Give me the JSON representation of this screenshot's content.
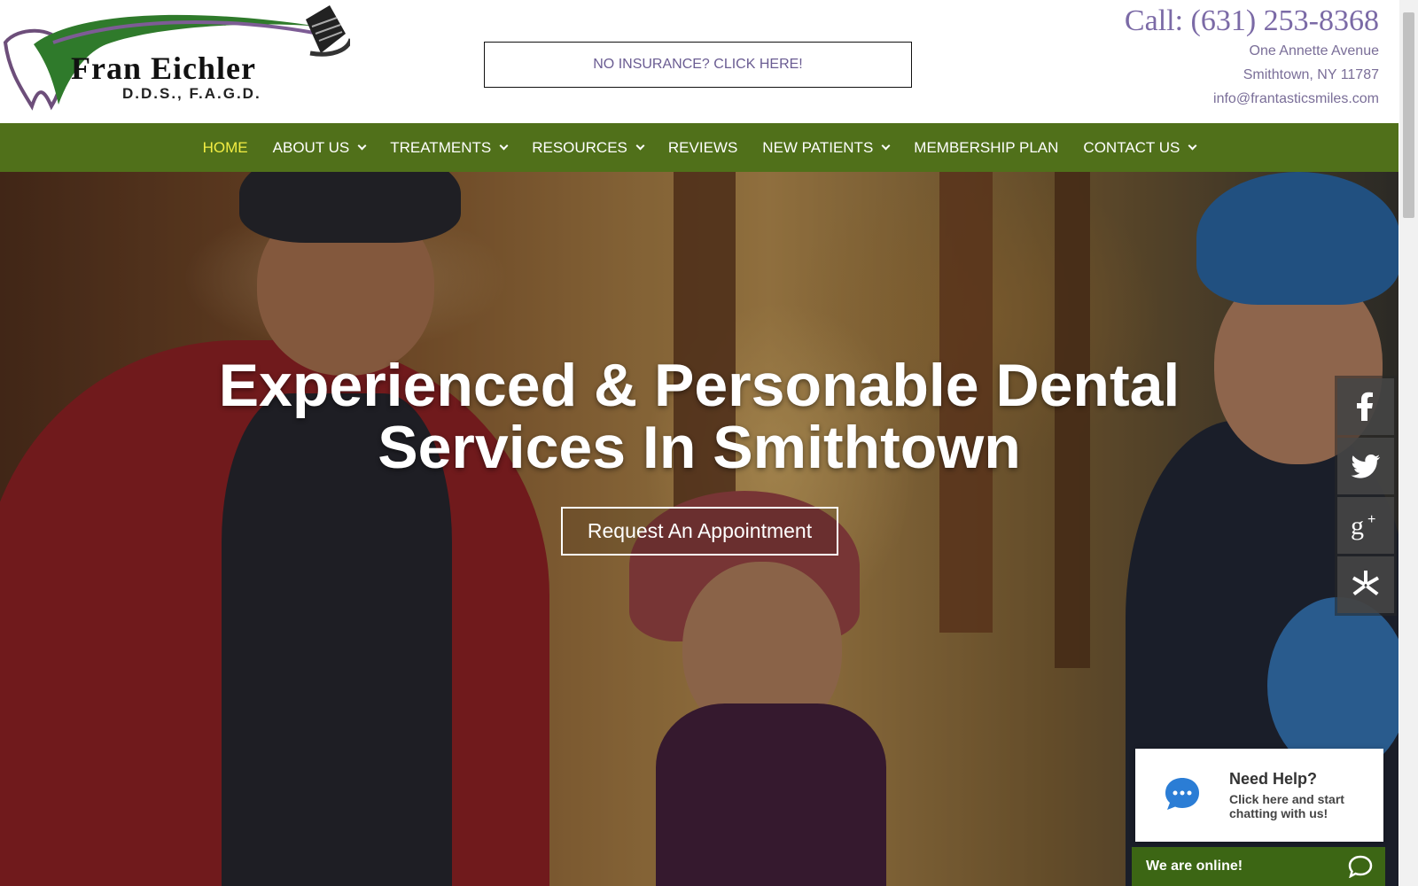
{
  "logo": {
    "name": "Fran Eichler",
    "credentials": "D.D.S., F.A.G.D."
  },
  "header": {
    "insurance_cta": "NO INSURANCE? CLICK HERE!",
    "phone": "Call: (631) 253-8368",
    "address_line1": "One Annette Avenue",
    "address_line2": "Smithtown, NY 11787",
    "email": "info@frantasticsmiles.com"
  },
  "nav": {
    "items": [
      {
        "label": "HOME",
        "active": true,
        "dropdown": false
      },
      {
        "label": "ABOUT US",
        "active": false,
        "dropdown": true
      },
      {
        "label": "TREATMENTS",
        "active": false,
        "dropdown": true
      },
      {
        "label": "RESOURCES",
        "active": false,
        "dropdown": true
      },
      {
        "label": "REVIEWS",
        "active": false,
        "dropdown": false
      },
      {
        "label": "NEW PATIENTS",
        "active": false,
        "dropdown": true
      },
      {
        "label": "MEMBERSHIP PLAN",
        "active": false,
        "dropdown": false
      },
      {
        "label": "CONTACT US",
        "active": false,
        "dropdown": true
      }
    ]
  },
  "hero": {
    "title_line1": "Experienced & Personable Dental",
    "title_line2": "Services In Smithtown",
    "cta": "Request An Appointment"
  },
  "social": {
    "icons": [
      "facebook-icon",
      "twitter-icon",
      "google-plus-icon",
      "yelp-icon"
    ]
  },
  "chat": {
    "title": "Need Help?",
    "text": "Click here and start chatting with us!",
    "status": "We are online!"
  },
  "colors": {
    "nav_bg": "#50701a",
    "nav_active": "#f3ee43",
    "accent_purple": "#7b6aa6",
    "chat_green": "#3c6614",
    "chat_blue": "#2b7dd5"
  }
}
